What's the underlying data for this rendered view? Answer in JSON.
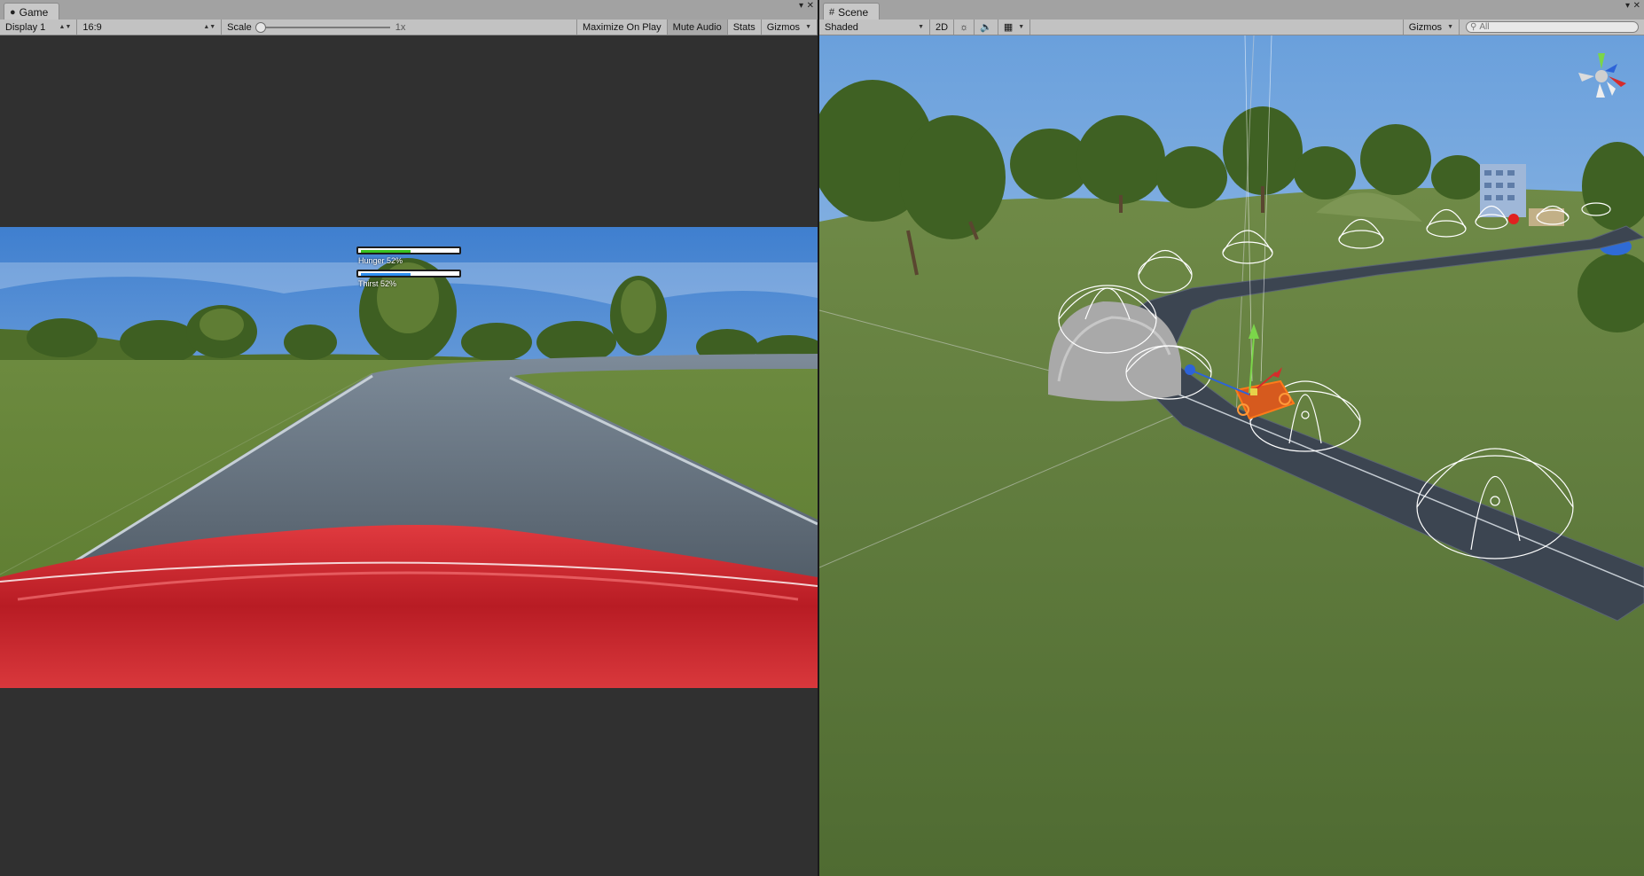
{
  "game": {
    "tab_title": "Game",
    "display": "Display 1",
    "aspect": "16:9",
    "scale_label": "Scale",
    "scale_value": "1x",
    "maximize_on_play": "Maximize On Play",
    "mute_audio": "Mute Audio",
    "stats": "Stats",
    "gizmos": "Gizmos",
    "hud": {
      "hunger_label": "Hunger 52%",
      "hunger_value": 0.52,
      "thirst_label": "Thirst 52%",
      "thirst_value": 0.52
    }
  },
  "scene": {
    "tab_title": "Scene",
    "shading_mode": "Shaded",
    "mode_2d": "2D",
    "gizmos": "Gizmos",
    "search_placeholder": "All"
  },
  "colors": {
    "hunger": "#39c21f",
    "thirst": "#2d8ef0",
    "car_red": "#c01e28",
    "selection_orange": "#ff7a1a"
  },
  "icons": [
    "game-tab-icon",
    "scene-tab-icon",
    "lighting-icon",
    "audio-icon",
    "effects-icon",
    "search-icon",
    "scene-gizmo-icon"
  ]
}
